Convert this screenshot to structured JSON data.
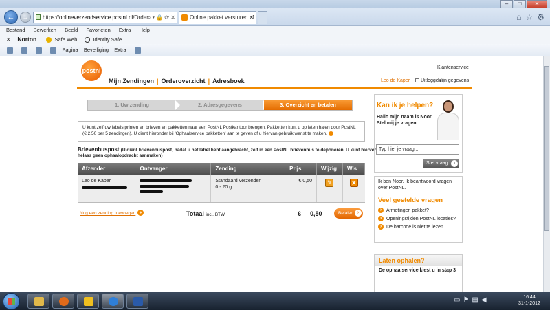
{
  "browser": {
    "url_prefix": "https://",
    "url_domain": "onlineverzendservice.postnl.nl",
    "url_suffix": "/Order",
    "tab_title": "Online pakket versturen of ..."
  },
  "menu": [
    "Bestand",
    "Bewerken",
    "Beeld",
    "Favorieten",
    "Extra",
    "Help"
  ],
  "norton": {
    "brand": "Norton",
    "safe_web": "Safe Web",
    "identity_safe": "Identity Safe"
  },
  "commandbar": {
    "page": "Pagina",
    "security": "Beveiliging",
    "extra": "Extra"
  },
  "site": {
    "logo": "postnl",
    "klantenservice": "Klantenservice",
    "nav": [
      "Mijn Zendingen",
      "Orderoverzicht",
      "Adresboek"
    ],
    "user": "Leo de Kaper",
    "logout": "Uitloggen",
    "my_data": "Mijn gegevens"
  },
  "steps": [
    "1. Uw zending",
    "2. Adresgegevens",
    "3. Overzicht en betalen"
  ],
  "info_text": "U kunt zelf uw labels printen en brieven en pakketten naar een PostNL Postkantoor brengen. Pakketten kunt u op laten halen door PostNL (€ 2,50 per 5 zendingen). U dient hieronder bij 'Ophaalservice pakketten' aan te geven of u hiervan gebruik wenst te maken.",
  "section": {
    "title": "Brievenbuspost",
    "note": "(U dient brievenbuspost, nadat u het label hebt aangebracht, zelf in een PostNL brievenbus te deponeren. U kunt hiervoor",
    "note2": "helaas geen ophaalopdracht aanmaken)"
  },
  "table": {
    "headers": [
      "Afzender",
      "Ontvanger",
      "Zending",
      "Prijs",
      "Wijzig",
      "Wis"
    ],
    "row": {
      "sender": "Leo de Kaper",
      "shipment_type": "Standaard verzenden",
      "weight": "0 - 20 g",
      "price": "€ 0,50"
    }
  },
  "footer": {
    "add_link": "Nog een zending toevoegen",
    "total_label": "Totaal",
    "total_note": "incl. BTW",
    "currency": "€",
    "total_amount": "0,50",
    "pay_button": "Betalen"
  },
  "help": {
    "title": "Kan ik je helpen?",
    "hello": "Hallo mijn naam is Noor. Stel mij je vragen",
    "input_placeholder": "Typ hier je vraag...",
    "ask_button": "Stel vraag"
  },
  "faq": {
    "intro": "Ik ben Noor. Ik beantwoord vragen over PostNL.",
    "title": "Veel gestelde vragen",
    "items": [
      "Afmetingen pakket?",
      "Openingstijden PostNL locaties?",
      "De barcode is niet te lezen."
    ]
  },
  "pickup": {
    "title": "Laten ophalen?",
    "subtitle": "De ophaalservice kiest u in stap 3"
  },
  "taskbar": {
    "time": "16:44",
    "date": "31-1-2012"
  },
  "colors": {
    "brand_orange": "#f08a00",
    "header_grey": "#5a5a5a"
  }
}
